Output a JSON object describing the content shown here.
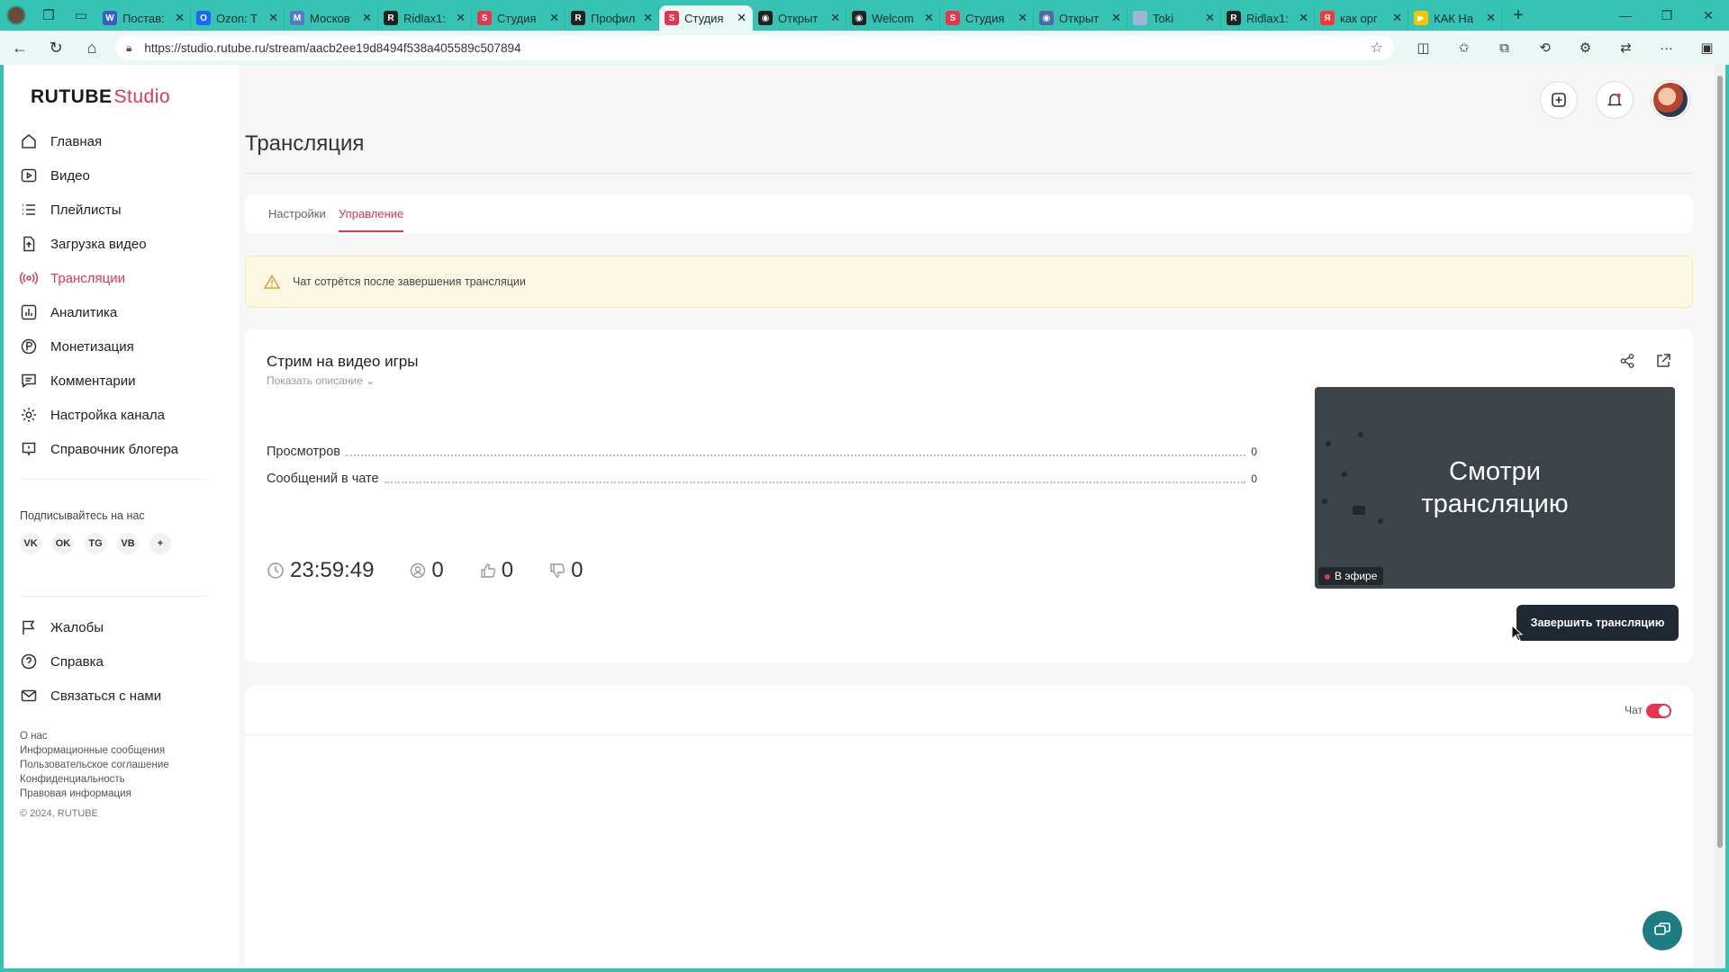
{
  "browser": {
    "tabs": [
      {
        "label": "Постав:",
        "fav": "W",
        "color": "#3a5bcc"
      },
      {
        "label": "Ozon: T",
        "fav": "O",
        "color": "#1a66ff"
      },
      {
        "label": "Москов",
        "fav": "M",
        "color": "#5a77c9"
      },
      {
        "label": "Ridlax1:",
        "fav": "R",
        "color": "#222222"
      },
      {
        "label": "Студия",
        "fav": "S",
        "color": "#e8344e"
      },
      {
        "label": "Профил",
        "fav": "R",
        "color": "#222222"
      },
      {
        "label": "Студия",
        "fav": "S",
        "color": "#e8344e"
      },
      {
        "label": "Открыт",
        "fav": "◉",
        "color": "#222222"
      },
      {
        "label": "Welcom",
        "fav": "◉",
        "color": "#222222"
      },
      {
        "label": "Студия",
        "fav": "S",
        "color": "#e8344e"
      },
      {
        "label": "Открыт",
        "fav": "◉",
        "color": "#4a6aa8"
      },
      {
        "label": "Toki",
        "fav": "",
        "color": "#9fb6d9"
      },
      {
        "label": "Ridlax1:",
        "fav": "R",
        "color": "#222222"
      },
      {
        "label": "как орг",
        "fav": "Я",
        "color": "#f33"
      },
      {
        "label": "КАК На",
        "fav": "▶",
        "color": "#f4c600"
      }
    ],
    "active_tab_index": 6,
    "url": "https://studio.rutube.ru/stream/aacb2ee19d8494f538a405589c507894"
  },
  "logo": {
    "brand": "RUTUBE",
    "suffix": "Studio"
  },
  "sidebar": {
    "items": [
      {
        "label": "Главная",
        "icon": "home-icon"
      },
      {
        "label": "Видео",
        "icon": "video-icon"
      },
      {
        "label": "Плейлисты",
        "icon": "playlist-icon"
      },
      {
        "label": "Загрузка видео",
        "icon": "upload-icon"
      },
      {
        "label": "Трансляции",
        "icon": "broadcast-icon"
      },
      {
        "label": "Аналитика",
        "icon": "analytics-icon"
      },
      {
        "label": "Монетизация",
        "icon": "monetization-icon"
      },
      {
        "label": "Комментарии",
        "icon": "comments-icon"
      },
      {
        "label": "Настройка канала",
        "icon": "settings-icon"
      },
      {
        "label": "Справочник блогера",
        "icon": "guide-icon"
      }
    ],
    "active_index": 4,
    "subscribe_label": "Подписывайтесь на нас",
    "socials": [
      "VK",
      "OK",
      "TG",
      "VB",
      "+"
    ],
    "items2": [
      {
        "label": "Жалобы",
        "icon": "flag-icon"
      },
      {
        "label": "Справка",
        "icon": "help-icon"
      },
      {
        "label": "Связаться с нами",
        "icon": "mail-icon"
      }
    ],
    "links": [
      "О нас",
      "Информационные сообщения",
      "Пользовательское соглашение",
      "Конфиденциальность",
      "Правовая информация"
    ],
    "copyright": "© 2024, RUTUBE"
  },
  "main": {
    "title": "Трансляция",
    "tabs": [
      {
        "label": "Настройки"
      },
      {
        "label": "Управление"
      }
    ],
    "active_tab": 1,
    "alert": "Чат сотрётся после завершения трансляции",
    "stream": {
      "title": "Стрим на видео игры",
      "show_description": "Показать описание",
      "stats": [
        {
          "label": "Просмотров",
          "value": "0"
        },
        {
          "label": "Сообщений в чате",
          "value": "0"
        }
      ],
      "timer": "23:59:49",
      "viewers": "0",
      "likes": "0",
      "dislikes": "0",
      "preview_text_1": "Смотри",
      "preview_text_2": "трансляцию",
      "live_badge": "В эфире",
      "end_button": "Завершить трансляцию"
    },
    "chat": {
      "label": "Чат",
      "enabled": true
    }
  },
  "colors": {
    "accent": "#e8344e",
    "browser": "#37c3b4",
    "dark_button": "#1f2933"
  }
}
